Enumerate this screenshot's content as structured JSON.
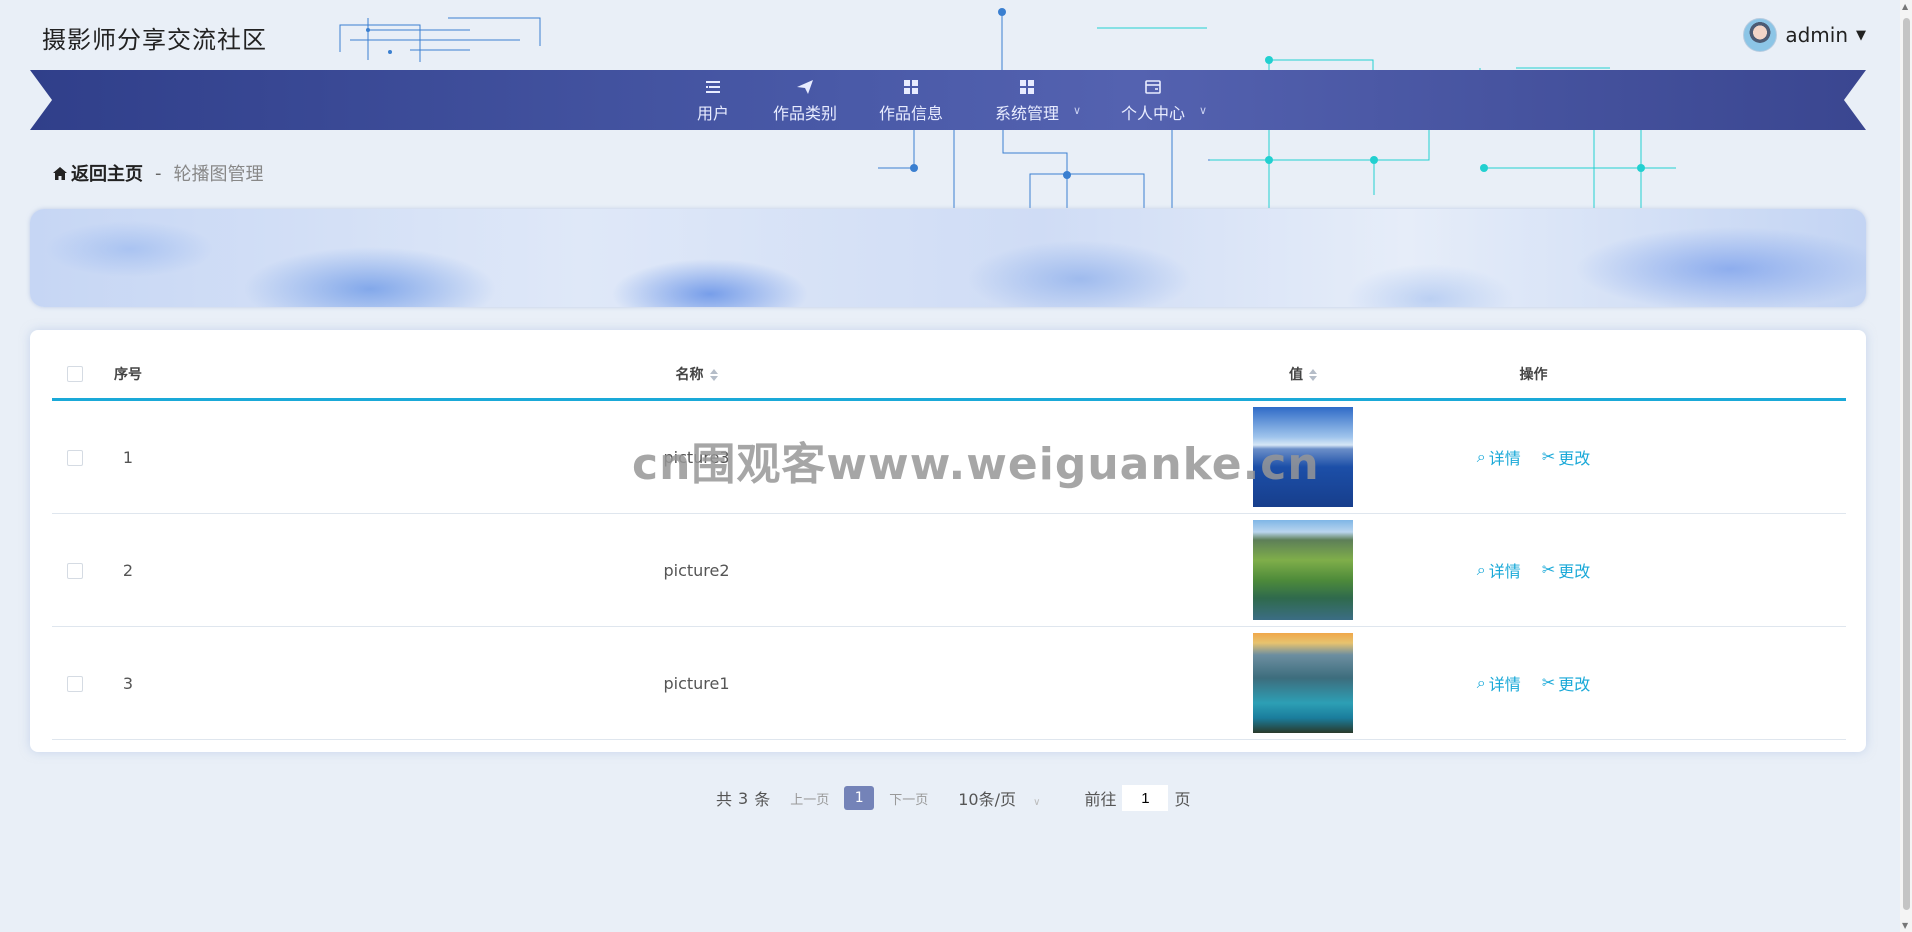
{
  "header": {
    "site_title": "摄影师分享交流社区",
    "user_name": "admin"
  },
  "nav": {
    "items": [
      {
        "label": "用户",
        "icon": "list-icon"
      },
      {
        "label": "作品类别",
        "icon": "send-icon"
      },
      {
        "label": "作品信息",
        "icon": "grid-icon"
      },
      {
        "label": "系统管理",
        "icon": "grid-icon",
        "has_dropdown": true
      },
      {
        "label": "个人中心",
        "icon": "wallet-icon",
        "has_dropdown": true
      }
    ]
  },
  "breadcrumb": {
    "home": "返回主页",
    "separator": "-",
    "current": "轮播图管理"
  },
  "table": {
    "headers": {
      "index": "序号",
      "name": "名称",
      "value": "值",
      "actions": "操作"
    },
    "rows": [
      {
        "index": "1",
        "name": "picture3",
        "image": "lake-mountain-blue"
      },
      {
        "index": "2",
        "name": "picture2",
        "image": "green-mountain-lake"
      },
      {
        "index": "3",
        "name": "picture1",
        "image": "sunset-mountain-lake"
      }
    ],
    "detail_label": "详情",
    "edit_label": "更改"
  },
  "pagination": {
    "total_prefix": "共",
    "total": "3",
    "total_suffix": "条",
    "prev": "上一页",
    "current_page": "1",
    "next": "下一页",
    "page_size": "10条/页",
    "goto_prefix": "前往",
    "goto_value": "1",
    "goto_suffix": "页"
  },
  "watermark": "cn围观客www.weiguanke.cn",
  "colors": {
    "accent": "#1aa9d8",
    "nav_bg": "#3f4f9c",
    "page_bg": "#e9eff7",
    "active_page": "#7483b8"
  }
}
